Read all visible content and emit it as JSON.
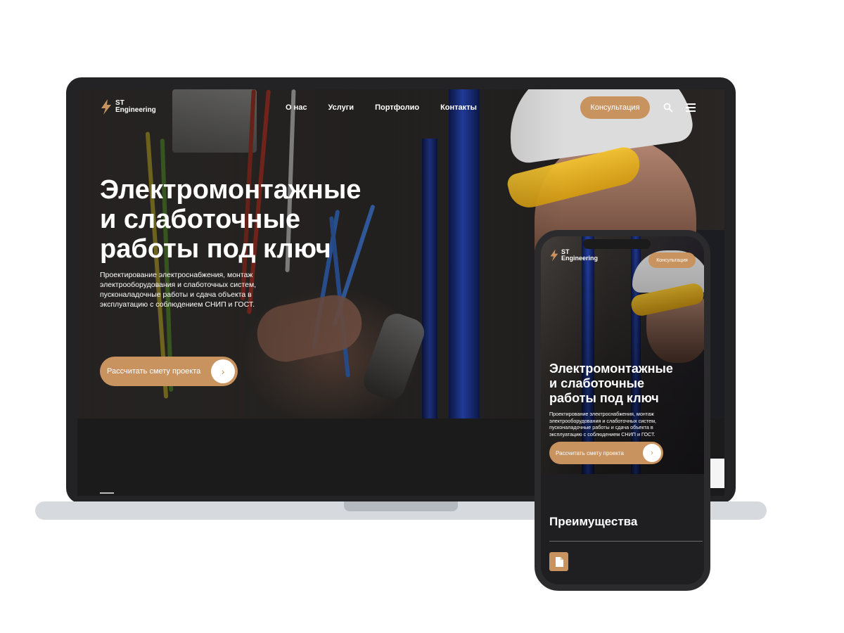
{
  "brand": {
    "line1": "ST",
    "line2": "Engineering",
    "accent": "#c8935f"
  },
  "desktop": {
    "nav": [
      "О нас",
      "Услуги",
      "Портфолио",
      "Контакты"
    ],
    "cta": "Консультация",
    "title_lines": [
      "Электромонтажные",
      "и слаботочные",
      "работы под ключ"
    ],
    "description_lines": [
      "Проектирование электроснабжения, монтаж",
      "электрооборудования и слаботочных систем,",
      "пусконаладочные работы и сдача объекта в",
      "эксплуатацию с соблюдением СНИП и ГОСТ."
    ],
    "button": "Рассчитать смету проекта",
    "button_arrow": "›"
  },
  "mobile": {
    "cta": "Консультация",
    "title_lines": [
      "Электромонтажные",
      "и слаботочные",
      "работы под ключ"
    ],
    "description_lines": [
      "Проектирование электроснабжения, монтаж",
      "электрооборудования и слаботочных систем,",
      "пусконаладочные работы и сдача объекта в",
      "эксплуатацию с соблюдением СНИП и ГОСТ."
    ],
    "button": "Рассчитать смету проекта",
    "button_arrow": "›",
    "section_title": "Преимущества"
  }
}
